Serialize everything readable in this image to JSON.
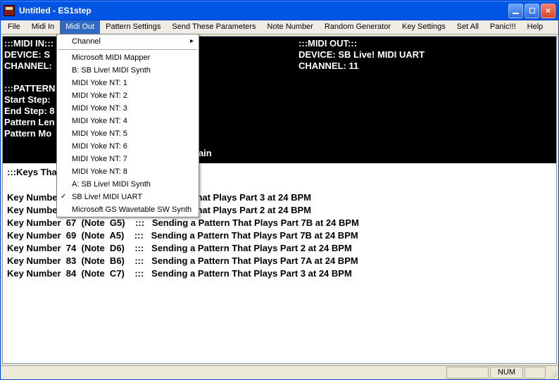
{
  "window": {
    "title": "Untitled - ES1step"
  },
  "menu": {
    "items": [
      "File",
      "Midi In",
      "Midi Out",
      "Pattern Settings",
      "Send These Parameters",
      "Note Number",
      "Random Generator",
      "Key Settings",
      "Set All",
      "Panic!!!",
      "Help"
    ],
    "active_index": 2
  },
  "dropdown": {
    "channel_label": "Channel",
    "items": [
      "Microsoft MIDI Mapper",
      "B: SB Live! MIDI Synth",
      "MIDI Yoke NT:  1",
      "MIDI Yoke NT:  2",
      "MIDI Yoke NT:  3",
      "MIDI Yoke NT:  4",
      "MIDI Yoke NT:  5",
      "MIDI Yoke NT:  6",
      "MIDI Yoke NT:  7",
      "MIDI Yoke NT:  8",
      "A: SB Live! MIDI Synth",
      "SB Live! MIDI UART",
      "Microsoft GS Wavetable SW Synth"
    ],
    "checked_index": 11
  },
  "black": {
    "midi_in_header": ":::MIDI IN:::",
    "device_in_l": "DEVICE: S",
    "channel_in_l": "CHANNEL:",
    "pattern_hdr": ":::PATTERN",
    "start_step": "Start Step:",
    "end_step": "End Step: 8",
    "pat_len": "Pattern Len",
    "pat_mode": "Pattern Mo",
    "midi_out_header": ":::MIDI OUT:::",
    "device_out": "DEVICE: SB Live! MIDI UART",
    "channel_out": "CHANNEL: 11",
    "again": "gain"
  },
  "white": {
    "keys_that": ":::Keys Tha",
    "rows": [
      {
        "tail": "g a Pattern That Plays Part 3 at 24 BPM"
      },
      {
        "tail": "g a Pattern That Plays Part 2 at 24 BPM"
      },
      {
        "full": "Key Number  67  (Note  G5)    :::   Sending a Pattern That Plays Part 7B at 24 BPM"
      },
      {
        "full": "Key Number  69  (Note  A5)    :::   Sending a Pattern That Plays Part 7B at 24 BPM"
      },
      {
        "full": "Key Number  74  (Note  D6)    :::   Sending a Pattern That Plays Part 2 at 24 BPM"
      },
      {
        "full": "Key Number  83  (Note  B6)    :::   Sending a Pattern That Plays Part 7A at 24 BPM"
      },
      {
        "full": "Key Number  84  (Note  C7)    :::   Sending a Pattern That Plays Part 3 at 24 BPM"
      }
    ],
    "key_num_prefix0": "Key Numbe",
    "key_num_prefix1": "Key Numbe"
  },
  "statusbar": {
    "num": "NUM"
  }
}
